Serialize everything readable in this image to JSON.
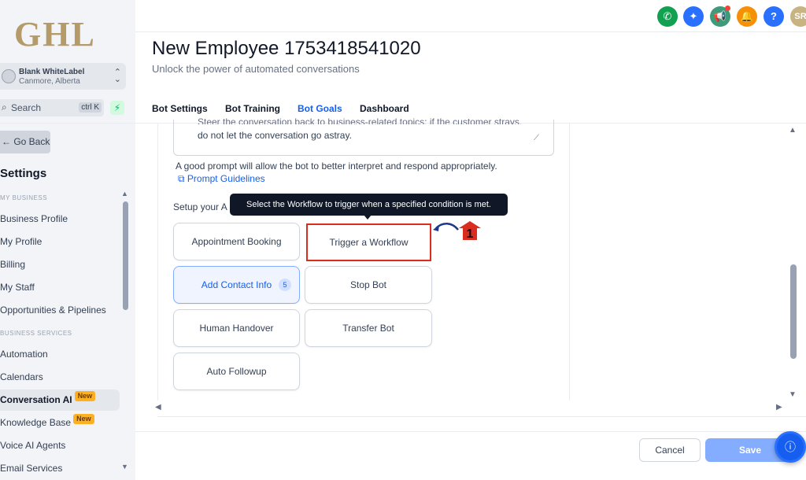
{
  "app": {
    "logo_text": "GHL"
  },
  "account": {
    "name": "Blank WhiteLabel",
    "location": "Canmore, Alberta"
  },
  "search": {
    "label": "Search",
    "shortcut": "ctrl K"
  },
  "sidebar": {
    "go_back": "← Go Back",
    "title": "Settings",
    "section_business": "MY BUSINESS",
    "section_services": "BUSINESS SERVICES",
    "items": [
      {
        "label": "Business Profile"
      },
      {
        "label": "My Profile"
      },
      {
        "label": "Billing"
      },
      {
        "label": "My Staff"
      },
      {
        "label": "Opportunities & Pipelines"
      },
      {
        "label": "Automation"
      },
      {
        "label": "Calendars"
      },
      {
        "label": "Conversation AI",
        "badge": "New"
      },
      {
        "label": "Knowledge Base",
        "badge": "New"
      },
      {
        "label": "Voice AI Agents"
      },
      {
        "label": "Email Services"
      }
    ]
  },
  "topbar": {
    "icons": [
      {
        "name": "phone-icon",
        "color": "#12a150",
        "glyph": "✆"
      },
      {
        "name": "magic-icon",
        "color": "#2970ff",
        "glyph": "✦"
      },
      {
        "name": "megaphone-icon",
        "color": "#3f9a7a",
        "glyph": "📢"
      },
      {
        "name": "bell-icon",
        "color": "#f79009",
        "glyph": "🔔"
      },
      {
        "name": "help-icon",
        "color": "#2970ff",
        "glyph": "?"
      },
      {
        "name": "avatar",
        "color": "#c8b383",
        "glyph": "SR"
      }
    ]
  },
  "header": {
    "title": "New Employee 1753418541020",
    "subtitle": "Unlock the power of automated conversations"
  },
  "tabs": [
    {
      "label": "Bot Settings"
    },
    {
      "label": "Bot Training"
    },
    {
      "label": "Bot Goals"
    },
    {
      "label": "Dashboard"
    }
  ],
  "prompt": {
    "partial_line": "Steer the conversation back to business-related topics; if the customer strays,",
    "last_line": "do not let the conversation go astray.",
    "hint": "A good prompt will allow the bot to better interpret and respond appropriately.",
    "guidelines_link": "Prompt Guidelines"
  },
  "actions": {
    "setup_label": "Setup your A",
    "tooltip": "Select the Workflow to trigger when a specified condition is met.",
    "buttons": [
      {
        "label": "Appointment Booking"
      },
      {
        "label": "Trigger a Workflow"
      },
      {
        "label": "Add Contact Info",
        "count": "5"
      },
      {
        "label": "Stop Bot"
      },
      {
        "label": "Human Handover"
      },
      {
        "label": "Transfer Bot"
      },
      {
        "label": "Auto Followup"
      }
    ],
    "step_number": "1"
  },
  "footer": {
    "cancel": "Cancel",
    "save": "Save"
  }
}
